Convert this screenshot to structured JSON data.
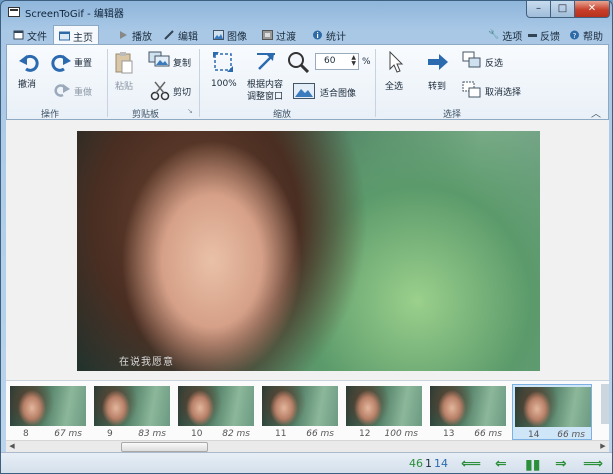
{
  "window": {
    "title": "ScreenToGif - 编辑器",
    "min_label": "–",
    "max_label": "□",
    "close_label": "✕"
  },
  "tabs": [
    {
      "label": "文件",
      "icon": "file-icon"
    },
    {
      "label": "主页",
      "icon": "home-icon",
      "active": true
    },
    {
      "label": "播放",
      "icon": "play-icon"
    },
    {
      "label": "编辑",
      "icon": "pencil-icon"
    },
    {
      "label": "图像",
      "icon": "image-icon"
    },
    {
      "label": "过渡",
      "icon": "transition-icon"
    },
    {
      "label": "统计",
      "icon": "info-icon"
    }
  ],
  "top_right": {
    "options": "选项",
    "feedback": "反馈",
    "help": "帮助"
  },
  "ribbon": {
    "undo": "撤消",
    "redo": "重置",
    "reset": "重做",
    "group_action": "操作",
    "paste": "粘贴",
    "copy": "复制",
    "cut": "剪切",
    "group_clipboard": "剪贴板",
    "zoom100": "100%",
    "fit_content_1": "根据内容",
    "fit_content_2": "调整窗口",
    "fit_image": "适合图像",
    "zoom_value": "60",
    "zoom_unit": "%",
    "group_zoom": "缩放",
    "select_all": "全选",
    "goto": "转到",
    "invert": "反选",
    "deselect": "取消选择",
    "group_select": "选择"
  },
  "canvas": {
    "subtitle": "在说我愿意"
  },
  "frames": [
    {
      "num": "8",
      "ms": "67 ms"
    },
    {
      "num": "9",
      "ms": "83 ms"
    },
    {
      "num": "10",
      "ms": "82 ms"
    },
    {
      "num": "11",
      "ms": "66 ms"
    },
    {
      "num": "12",
      "ms": "100 ms"
    },
    {
      "num": "13",
      "ms": "66 ms"
    },
    {
      "num": "14",
      "ms": "66 ms",
      "selected": true
    }
  ],
  "status": {
    "total": "46",
    "selected": "1",
    "current": "14"
  },
  "colors": {
    "accent": "#2c8f3a",
    "selection": "#cfe5f8",
    "title_bar": "#8fb6db"
  }
}
